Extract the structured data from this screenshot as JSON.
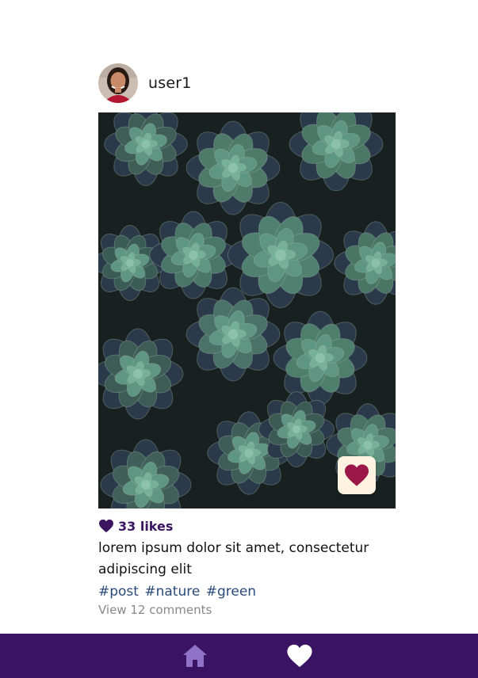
{
  "post": {
    "username": "user1",
    "likes": "33 likes",
    "caption": "lorem ipsum dolor sit amet, consectetur adipiscing elit",
    "hashtags": [
      "#post",
      "#nature",
      "#green"
    ],
    "comments_link": "View 12 comments",
    "avatar_icon": "user-avatar-photo",
    "photo_subject": "succulents",
    "like_overlay_icon": "heart-icon"
  },
  "nav": {
    "home_icon": "home-icon",
    "likes_icon": "heart-icon"
  },
  "colors": {
    "brand_purple": "#3a1463",
    "like_heart": "#9b1747",
    "likes_text": "#3b1560",
    "hashtag": "#2a4a7a",
    "overlay_bg": "#fdf3e0",
    "nav_home_icon": "#8f73c8",
    "nav_heart_icon": "#ffffff"
  }
}
